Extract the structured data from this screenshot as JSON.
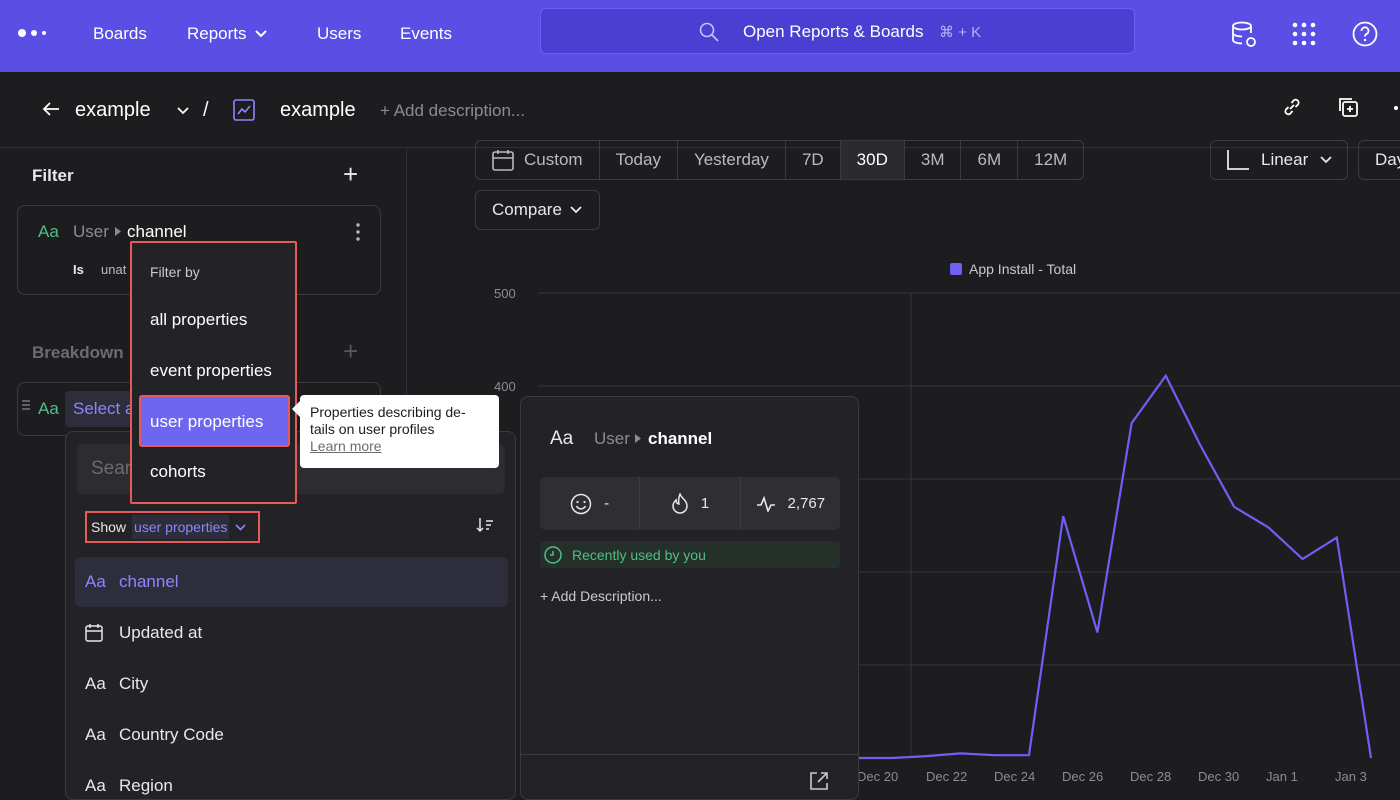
{
  "nav": {
    "items": [
      "Boards",
      "Reports",
      "Users",
      "Events"
    ],
    "search_text": "Open Reports & Boards",
    "search_shortcut": "⌘ + K"
  },
  "header": {
    "project": "example",
    "separator": "/",
    "report_name": "example",
    "add_description": "+ Add description..."
  },
  "filter": {
    "title": "Filter",
    "aa": "Aa",
    "entity": "User",
    "property": "channel",
    "operator": "Is",
    "value": "unat"
  },
  "breakdown": {
    "title": "Breakdown",
    "aa": "Aa",
    "select_text": "Select a"
  },
  "date_range": {
    "custom": "Custom",
    "ranges": [
      "Today",
      "Yesterday",
      "7D",
      "30D",
      "3M",
      "6M",
      "12M"
    ],
    "active": "30D"
  },
  "controls": {
    "linear": "Linear",
    "day": "Day",
    "compare": "Compare"
  },
  "property_panel": {
    "search_placeholder": "Sear",
    "show_label": "Show",
    "show_value": "user properties",
    "items": [
      {
        "icon": "Aa",
        "label": "channel"
      },
      {
        "icon": "calendar",
        "label": "Updated at"
      },
      {
        "icon": "Aa",
        "label": "City"
      },
      {
        "icon": "Aa",
        "label": "Country Code"
      },
      {
        "icon": "Aa",
        "label": "Region"
      }
    ]
  },
  "filter_menu": {
    "title": "Filter by",
    "items": [
      "all properties",
      "event properties",
      "user properties",
      "cohorts"
    ],
    "selected": "user properties"
  },
  "tooltip": {
    "line1": "Properties describing de-",
    "line2": "tails on user profiles",
    "link": "Learn more"
  },
  "detail_card": {
    "aa": "Aa",
    "entity": "User",
    "property": "channel",
    "stat_emoji": "-",
    "stat_fire": "1",
    "stat_activity": "2,767",
    "recent": "Recently used by you",
    "add_description": "+ Add Description..."
  },
  "chart_data": {
    "type": "line",
    "legend": "App Install - Total",
    "color": "#6f5ff5",
    "y_ticks": [
      "500",
      "400"
    ],
    "x_ticks": [
      "Dec 20",
      "Dec 22",
      "Dec 24",
      "Dec 26",
      "Dec 28",
      "Dec 30",
      "Jan 1",
      "Jan 3"
    ],
    "x": [
      "Dec 20",
      "Dec 21",
      "Dec 22",
      "Dec 23",
      "Dec 24",
      "Dec 25",
      "Dec 26",
      "Dec 27",
      "Dec 28",
      "Dec 29",
      "Dec 30",
      "Dec 31",
      "Jan 1",
      "Jan 2",
      "Jan 3",
      "Jan 4"
    ],
    "values": [
      0,
      0,
      2,
      5,
      3,
      3,
      260,
      135,
      360,
      411,
      337,
      270,
      248,
      214,
      237,
      0
    ],
    "ylim": [
      0,
      500
    ]
  }
}
